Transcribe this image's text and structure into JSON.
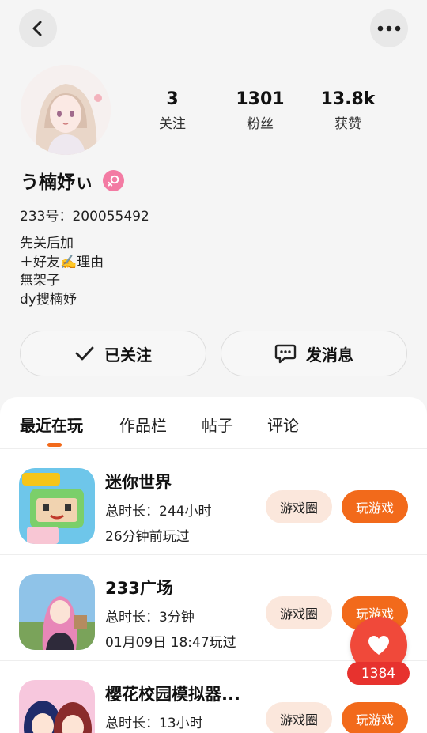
{
  "header": {
    "back_icon": "chevron-left-icon",
    "more_icon": "ellipsis-icon"
  },
  "profile": {
    "nickname": "う楠妤ぃ",
    "gender_icon": "female-icon",
    "gender_color": "#f37ba3",
    "uid": "233号：200055492",
    "bio": [
      "先关后加",
      "＋好友✍️理由",
      "無架子",
      "dy搜楠妤"
    ],
    "stats": [
      {
        "value": "3",
        "label": "关注"
      },
      {
        "value": "1301",
        "label": "粉丝"
      },
      {
        "value": "13.8k",
        "label": "获赞"
      }
    ]
  },
  "actions": {
    "follow_label": "已关注",
    "message_label": "发消息"
  },
  "tabs": [
    {
      "label": "最近在玩",
      "active": true
    },
    {
      "label": "作品栏",
      "active": false
    },
    {
      "label": "帖子",
      "active": false
    },
    {
      "label": "评论",
      "active": false
    }
  ],
  "games": [
    {
      "name": "迷你世界",
      "line1": "总时长：244小时",
      "line2": "26分钟前玩过",
      "circle_label": "游戏圈",
      "play_label": "玩游戏"
    },
    {
      "name": "233广场",
      "line1": "总时长：3分钟",
      "line2": "01月09日 18:47玩过",
      "circle_label": "游戏圈",
      "play_label": "玩游戏"
    },
    {
      "name": "樱花校园模拟器...",
      "line1": "总时长：13小时",
      "line2": "",
      "circle_label": "游戏圈",
      "play_label": "玩游戏"
    }
  ],
  "floating": {
    "like_icon": "heart-icon",
    "like_count": "1384"
  },
  "colors": {
    "accent": "#f26a1b",
    "like_red": "#f0493a",
    "pill_light": "#fbe7dc"
  }
}
